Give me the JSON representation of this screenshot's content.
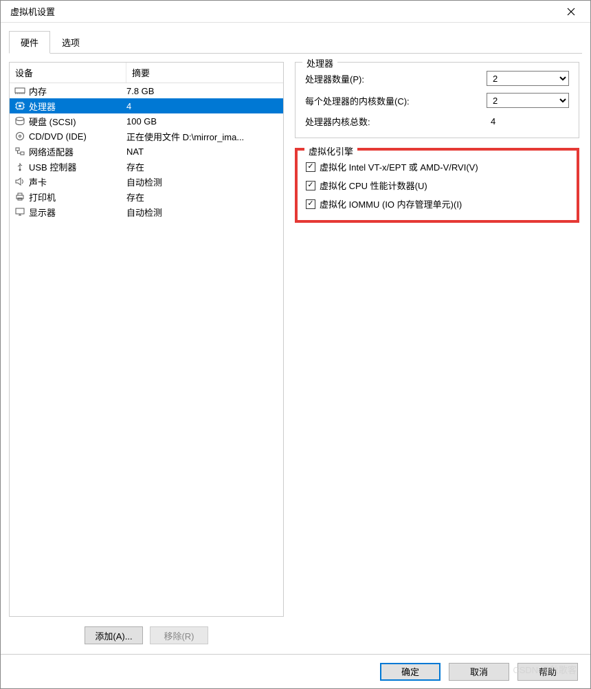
{
  "window": {
    "title": "虚拟机设置"
  },
  "tabs": {
    "hardware": "硬件",
    "options": "选项"
  },
  "list": {
    "col_device": "设备",
    "col_summary": "摘要",
    "items": [
      {
        "name": "内存",
        "summary": "7.8 GB",
        "icon": "memory"
      },
      {
        "name": "处理器",
        "summary": "4",
        "icon": "cpu",
        "selected": true
      },
      {
        "name": "硬盘 (SCSI)",
        "summary": "100 GB",
        "icon": "disk"
      },
      {
        "name": "CD/DVD (IDE)",
        "summary": "正在使用文件 D:\\mirror_ima...",
        "icon": "cd"
      },
      {
        "name": "网络适配器",
        "summary": "NAT",
        "icon": "network"
      },
      {
        "name": "USB 控制器",
        "summary": "存在",
        "icon": "usb"
      },
      {
        "name": "声卡",
        "summary": "自动检测",
        "icon": "sound"
      },
      {
        "name": "打印机",
        "summary": "存在",
        "icon": "printer"
      },
      {
        "name": "显示器",
        "summary": "自动检测",
        "icon": "display"
      }
    ]
  },
  "buttons": {
    "add": "添加(A)...",
    "remove": "移除(R)"
  },
  "processor": {
    "group_title": "处理器",
    "count_label": "处理器数量(P):",
    "count_value": "2",
    "cores_label": "每个处理器的内核数量(C):",
    "cores_value": "2",
    "total_label": "处理器内核总数:",
    "total_value": "4"
  },
  "virtualization": {
    "group_title": "虚拟化引擎",
    "vt_label": "虚拟化 Intel VT-x/EPT 或 AMD-V/RVI(V)",
    "vt_checked": true,
    "perf_label": "虚拟化 CPU 性能计数器(U)",
    "perf_checked": true,
    "iommu_label": "虚拟化 IOMMU (IO 内存管理单元)(I)",
    "iommu_checked": true
  },
  "footer": {
    "ok": "确定",
    "cancel": "取消",
    "help": "帮助"
  },
  "watermark": "CSDN @秋歌客"
}
